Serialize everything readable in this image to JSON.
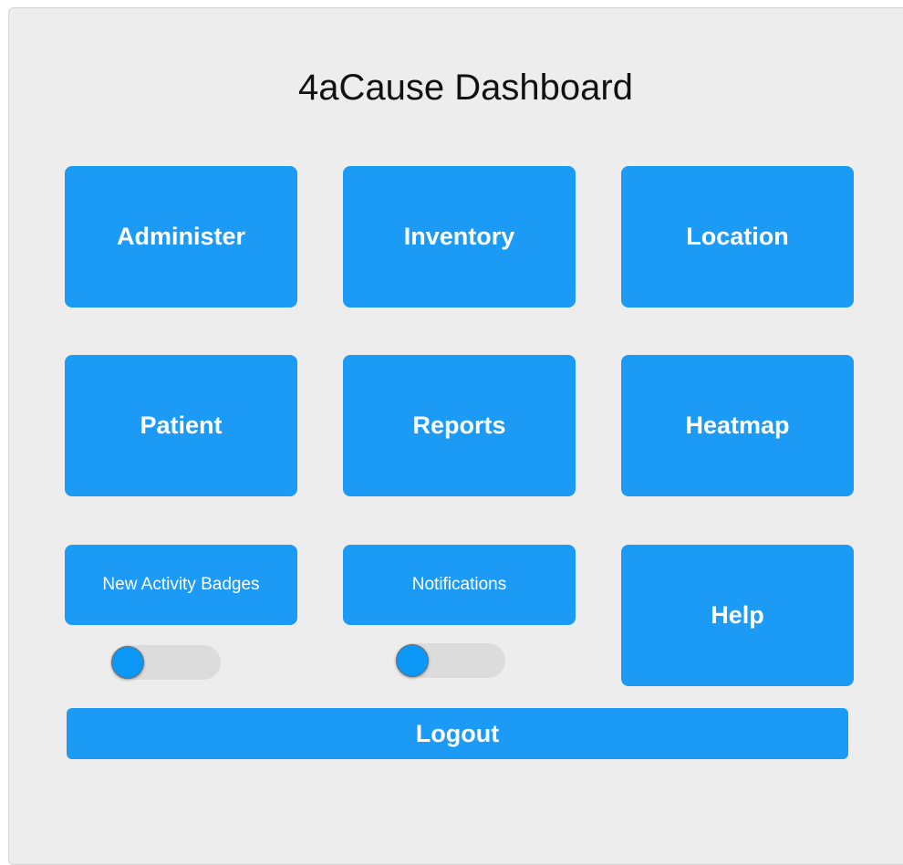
{
  "title": "4aCause Dashboard",
  "tiles": {
    "administer": "Administer",
    "inventory": "Inventory",
    "location": "Location",
    "patient": "Patient",
    "reports": "Reports",
    "heatmap": "Heatmap",
    "help": "Help"
  },
  "toggles": {
    "new_activity_badges": {
      "label": "New Activity Badges",
      "on": false
    },
    "notifications": {
      "label": "Notifications",
      "on": false
    }
  },
  "logout_label": "Logout",
  "colors": {
    "tile": "#1c9bf6",
    "panel": "#ededed",
    "toggle_knob": "#0a97f5",
    "toggle_track": "#dcdcdc"
  }
}
